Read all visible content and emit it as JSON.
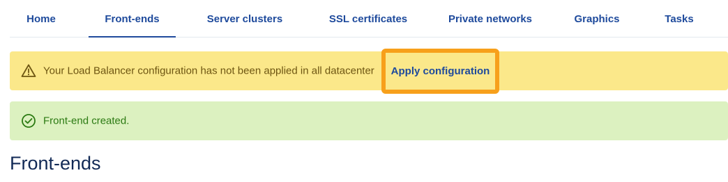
{
  "tabs": [
    {
      "label": "Home",
      "active": false
    },
    {
      "label": "Front-ends",
      "active": true
    },
    {
      "label": "Server clusters",
      "active": false
    },
    {
      "label": "SSL certificates",
      "active": false
    },
    {
      "label": "Private networks",
      "active": false
    },
    {
      "label": "Graphics",
      "active": false
    },
    {
      "label": "Tasks",
      "active": false
    }
  ],
  "warning": {
    "icon": "warning-triangle-icon",
    "message": "Your Load Balancer configuration has not been applied in all datacenter",
    "action_label": "Apply configuration"
  },
  "success": {
    "icon": "check-circle-icon",
    "message": "Front-end created."
  },
  "page": {
    "title": "Front-ends"
  },
  "colors": {
    "accent": "#1e4a9c",
    "warning_bg": "#fbe88a",
    "success_bg": "#dcf1c0",
    "highlight": "#f7a01b"
  }
}
